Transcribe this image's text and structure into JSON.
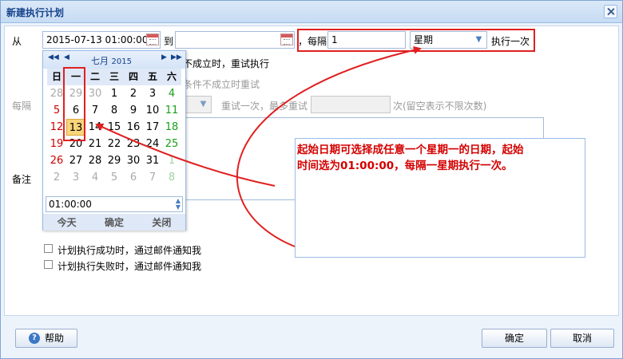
{
  "window": {
    "title": "新建执行计划"
  },
  "schedule": {
    "from_label": "从",
    "start_value": "2015-07-13 01:00:00",
    "to_label": "到",
    "end_value": "",
    "every_label": "每隔",
    "every_value": "1",
    "unit_value": "星期",
    "run_once_label": "执行一次"
  },
  "retry": {
    "condition_text": "不成立时，重试执行",
    "condition_text2": "条件不成立时重试",
    "every_label": "每隔",
    "retry_text": "重试一次，最多重试",
    "times_suffix": "次(留空表示不限次数)"
  },
  "note": {
    "label": "备注"
  },
  "calendar": {
    "month_label": "七月",
    "year_label": "2015",
    "weekdays": [
      "日",
      "一",
      "二",
      "三",
      "四",
      "五",
      "六"
    ],
    "weeks": [
      [
        "28",
        "29",
        "30",
        "1",
        "2",
        "3",
        "4"
      ],
      [
        "5",
        "6",
        "7",
        "8",
        "9",
        "10",
        "11"
      ],
      [
        "12",
        "13",
        "14",
        "15",
        "16",
        "17",
        "18"
      ],
      [
        "19",
        "20",
        "21",
        "22",
        "23",
        "24",
        "25"
      ],
      [
        "26",
        "27",
        "28",
        "29",
        "30",
        "31",
        "1"
      ],
      [
        "2",
        "3",
        "4",
        "5",
        "6",
        "7",
        "8"
      ]
    ],
    "selected_day": "13",
    "time_value": "01:00:00",
    "today_label": "今天",
    "ok_label": "确定",
    "close_label": "关闭"
  },
  "notify": {
    "success_label": "计划执行成功时，通过邮件通知我",
    "failure_label": "计划执行失败时，通过邮件通知我"
  },
  "annotation": {
    "line1": "起始日期可选择成任意一个星期一的日期，起始",
    "line2": "时间选为01:00:00，每隔一星期执行一次。"
  },
  "footer": {
    "help_label": "帮助",
    "ok_label": "确定",
    "cancel_label": "取消"
  },
  "colors": {
    "annotation_red": "#e02020",
    "selected_day_bg": "#f9d57a"
  }
}
